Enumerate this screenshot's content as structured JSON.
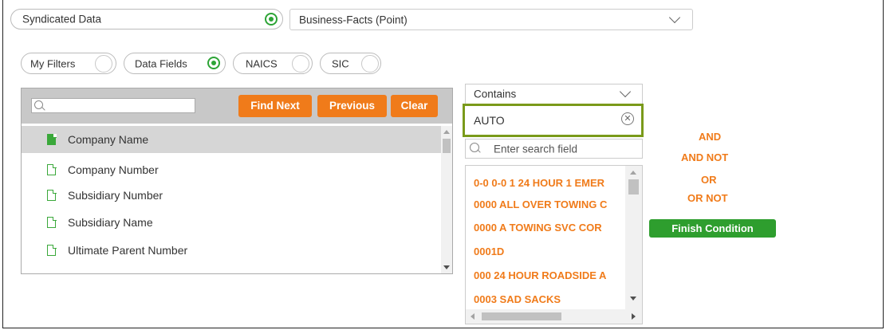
{
  "source": {
    "value": "Syndicated Data"
  },
  "dataset": {
    "value": "Business-Facts (Point)"
  },
  "filter_tabs": [
    {
      "label": "My Filters",
      "selected": false
    },
    {
      "label": "Data Fields",
      "selected": true
    },
    {
      "label": "NAICS",
      "selected": false
    },
    {
      "label": "SIC",
      "selected": false
    }
  ],
  "field_panel": {
    "search_value": "",
    "buttons": {
      "find_next": "Find Next",
      "previous": "Previous",
      "clear": "Clear"
    },
    "fields": [
      {
        "label": "Company Name",
        "selected": true
      },
      {
        "label": "Company Number",
        "selected": false
      },
      {
        "label": "Subsidiary Number",
        "selected": false
      },
      {
        "label": "Subsidiary Name",
        "selected": false
      },
      {
        "label": "Ultimate Parent Number",
        "selected": false
      }
    ]
  },
  "condition": {
    "operator": "Contains",
    "value": "AUTO",
    "search_placeholder": "Enter search field",
    "values": [
      "0-0 0-0 1 24 HOUR 1 EMER",
      "0000 ALL OVER TOWING C",
      "0000 A TOWING SVC COR",
      "0001D",
      "000 24 HOUR ROADSIDE A",
      "0003 SAD SACKS"
    ]
  },
  "logic": {
    "and": "AND",
    "and_not": "AND NOT",
    "or": "OR",
    "or_not": "OR NOT",
    "finish_label": "Finish Condition"
  },
  "colors": {
    "accent_green": "#2da436",
    "button_orange": "#f07b1a",
    "highlight_border": "#7a9a1a"
  }
}
